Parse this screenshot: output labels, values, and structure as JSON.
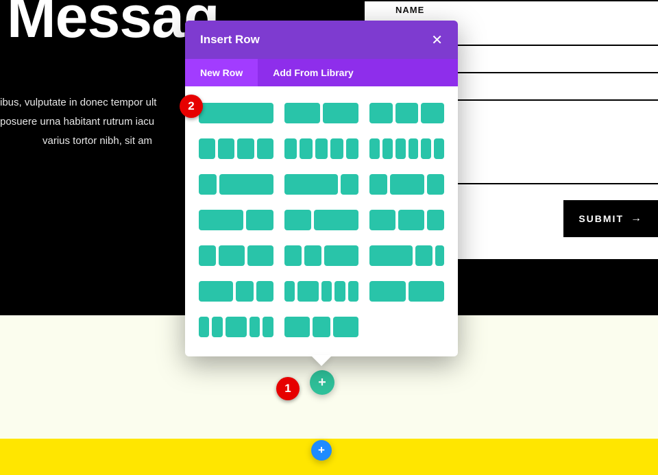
{
  "hero": {
    "title": "Messag",
    "line1": "ibus, vulputate in donec tempor ult",
    "line2": "posuere urna habitant rutrum iacu",
    "line3": "varius tortor nibh, sit am"
  },
  "form": {
    "name_label": "NAME",
    "submit_label": "SUBMIT",
    "arrow": "→"
  },
  "popover": {
    "title": "Insert Row",
    "close": "✕",
    "tabs": {
      "new_row": "New Row",
      "from_library": "Add From Library"
    },
    "layouts": [
      [
        1
      ],
      [
        1,
        1
      ],
      [
        1,
        1,
        1
      ],
      [
        1,
        1,
        1,
        1
      ],
      [
        1,
        1,
        1,
        1,
        1
      ],
      [
        1,
        1,
        1,
        1,
        1,
        1
      ],
      [
        2,
        6
      ],
      [
        6,
        2
      ],
      [
        2,
        4,
        2
      ],
      [
        5,
        3
      ],
      [
        3,
        5
      ],
      [
        3,
        3,
        2
      ],
      [
        2,
        3,
        3
      ],
      [
        2,
        2,
        4
      ],
      [
        5,
        2,
        1
      ],
      [
        4,
        2,
        2
      ],
      [
        1,
        2,
        1,
        1,
        1
      ],
      [
        4,
        4
      ],
      [
        2,
        2,
        4,
        2,
        2
      ],
      [
        3,
        2,
        3
      ]
    ]
  },
  "markers": {
    "one": "1",
    "two": "2"
  },
  "icons": {
    "plus": "+"
  }
}
